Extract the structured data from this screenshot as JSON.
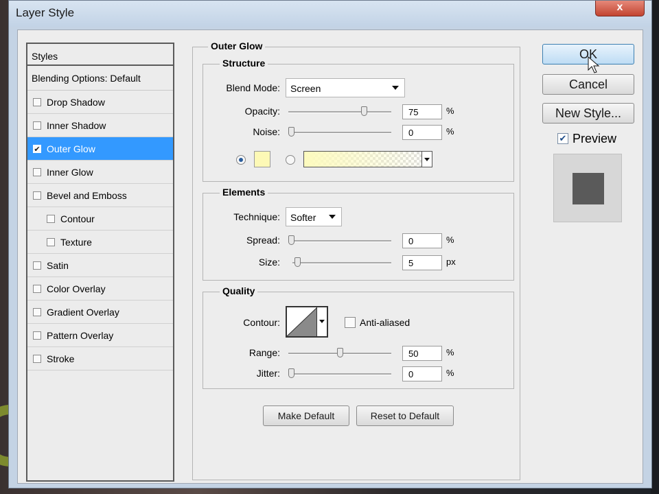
{
  "window": {
    "title": "Layer Style",
    "close_label": "x"
  },
  "styles_list": {
    "header": "Styles",
    "blending_options": "Blending Options: Default",
    "items": [
      {
        "label": "Drop Shadow",
        "checked": false,
        "selected": false
      },
      {
        "label": "Inner Shadow",
        "checked": false,
        "selected": false
      },
      {
        "label": "Outer Glow",
        "checked": true,
        "selected": true
      },
      {
        "label": "Inner Glow",
        "checked": false,
        "selected": false
      },
      {
        "label": "Bevel and Emboss",
        "checked": false,
        "selected": false
      },
      {
        "label": "Contour",
        "checked": false,
        "selected": false,
        "indent": true
      },
      {
        "label": "Texture",
        "checked": false,
        "selected": false,
        "indent": true
      },
      {
        "label": "Satin",
        "checked": false,
        "selected": false
      },
      {
        "label": "Color Overlay",
        "checked": false,
        "selected": false
      },
      {
        "label": "Gradient Overlay",
        "checked": false,
        "selected": false
      },
      {
        "label": "Pattern Overlay",
        "checked": false,
        "selected": false
      },
      {
        "label": "Stroke",
        "checked": false,
        "selected": false
      }
    ]
  },
  "outer_glow": {
    "title": "Outer Glow",
    "structure": {
      "title": "Structure",
      "blend_mode_label": "Blend Mode:",
      "blend_mode_value": "Screen",
      "opacity_label": "Opacity:",
      "opacity_value": "75",
      "opacity_unit": "%",
      "opacity_fraction": 0.75,
      "noise_label": "Noise:",
      "noise_value": "0",
      "noise_unit": "%",
      "noise_fraction": 0,
      "glow_color": "#fdf9b6",
      "color_mode": "solid"
    },
    "elements": {
      "title": "Elements",
      "technique_label": "Technique:",
      "technique_value": "Softer",
      "spread_label": "Spread:",
      "spread_value": "0",
      "spread_unit": "%",
      "spread_fraction": 0,
      "size_label": "Size:",
      "size_value": "5",
      "size_unit": "px",
      "size_fraction": 0.02
    },
    "quality": {
      "title": "Quality",
      "contour_label": "Contour:",
      "anti_aliased_label": "Anti-aliased",
      "anti_aliased": false,
      "range_label": "Range:",
      "range_value": "50",
      "range_unit": "%",
      "range_fraction": 0.5,
      "jitter_label": "Jitter:",
      "jitter_value": "0",
      "jitter_unit": "%",
      "jitter_fraction": 0
    },
    "make_default_label": "Make Default",
    "reset_default_label": "Reset to Default"
  },
  "actions": {
    "ok_label": "OK",
    "cancel_label": "Cancel",
    "new_style_label": "New Style...",
    "preview_label": "Preview",
    "preview_checked": true
  }
}
